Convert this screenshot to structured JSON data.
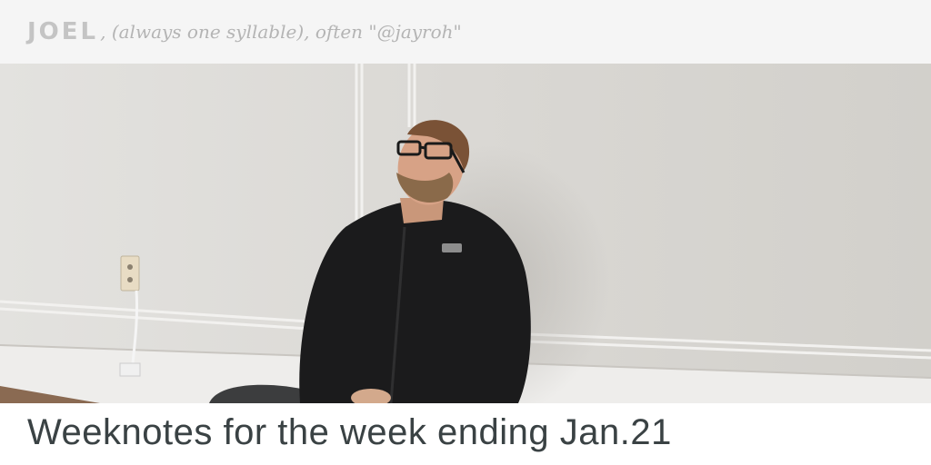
{
  "header": {
    "site_name": "JOEL",
    "tagline": ", (always one syllable), often \"@jayroh\""
  },
  "hero": {
    "alt": "Man in a black fleece jacket sitting against a white wall with eyes closed"
  },
  "post": {
    "title": "Weeknotes for the week ending Jan.21"
  }
}
